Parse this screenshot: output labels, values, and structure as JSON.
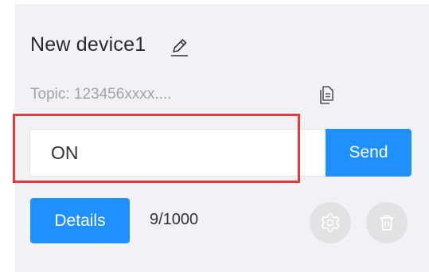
{
  "device": {
    "name": "New device1",
    "topic": "Topic: 123456xxxx...."
  },
  "message": {
    "value": "ON"
  },
  "actions": {
    "send_label": "Send",
    "details_label": "Details"
  },
  "counter": {
    "text": "9/1000"
  },
  "icons": {
    "edit": "edit-icon",
    "copy": "copy-icon",
    "settings": "gear-icon",
    "delete": "trash-icon"
  },
  "colors": {
    "accent": "#1e90ff",
    "card_bg": "#f1f2f5",
    "highlight": "#e8383d",
    "round_button_bg": "#e2e2e4"
  }
}
